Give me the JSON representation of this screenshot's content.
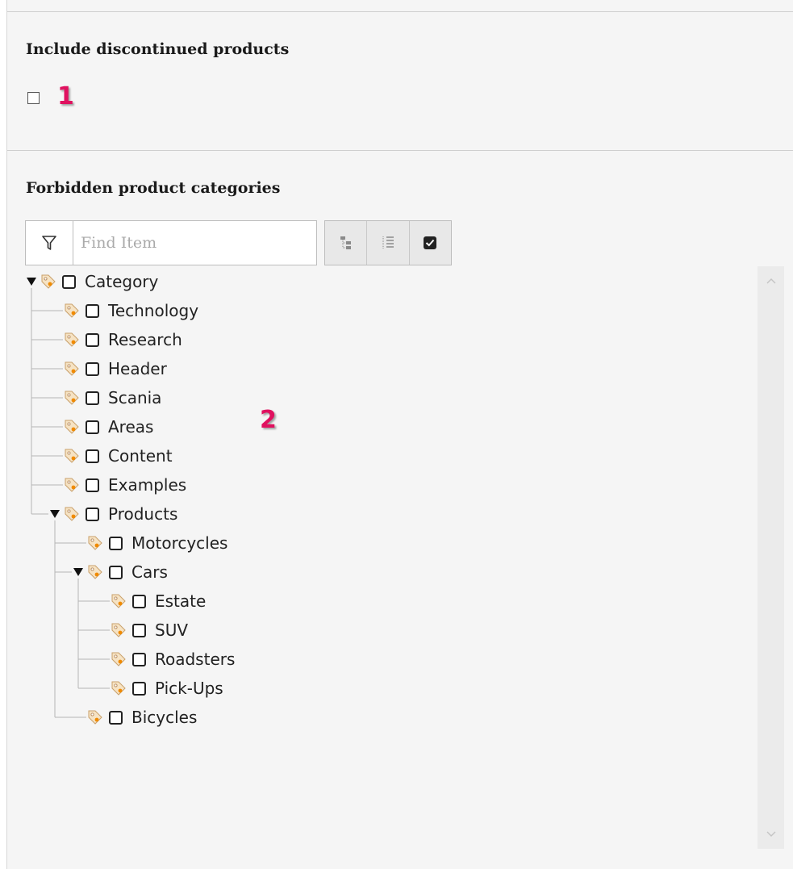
{
  "sections": {
    "discontinued": {
      "title": "Include discontinued products",
      "marker": "1"
    },
    "forbidden": {
      "title": "Forbidden product categories",
      "marker": "2"
    }
  },
  "search": {
    "placeholder": "Find Item"
  },
  "toolbar": [
    {
      "name": "show-tree-button",
      "icon": "tree-icon"
    },
    {
      "name": "expand-all-button",
      "icon": "list-icon"
    },
    {
      "name": "select-all-button",
      "icon": "checkbox-checked-icon"
    }
  ],
  "tree": [
    {
      "label": "Category",
      "depth": 0,
      "expanded": true
    },
    {
      "label": "Technology",
      "depth": 1
    },
    {
      "label": "Research",
      "depth": 1
    },
    {
      "label": "Header",
      "depth": 1
    },
    {
      "label": "Scania",
      "depth": 1
    },
    {
      "label": "Areas",
      "depth": 1
    },
    {
      "label": "Content",
      "depth": 1
    },
    {
      "label": "Examples",
      "depth": 1
    },
    {
      "label": "Products",
      "depth": 1,
      "expanded": true
    },
    {
      "label": "Motorcycles",
      "depth": 2
    },
    {
      "label": "Cars",
      "depth": 2,
      "expanded": true
    },
    {
      "label": "Estate",
      "depth": 3
    },
    {
      "label": "SUV",
      "depth": 3
    },
    {
      "label": "Roadsters",
      "depth": 3
    },
    {
      "label": "Pick-Ups",
      "depth": 3
    },
    {
      "label": "Bicycles",
      "depth": 2
    }
  ],
  "colors": {
    "marker": "#e0115f",
    "tag_fill": "#f6e3c4",
    "tag_dot": "#f08a00"
  }
}
